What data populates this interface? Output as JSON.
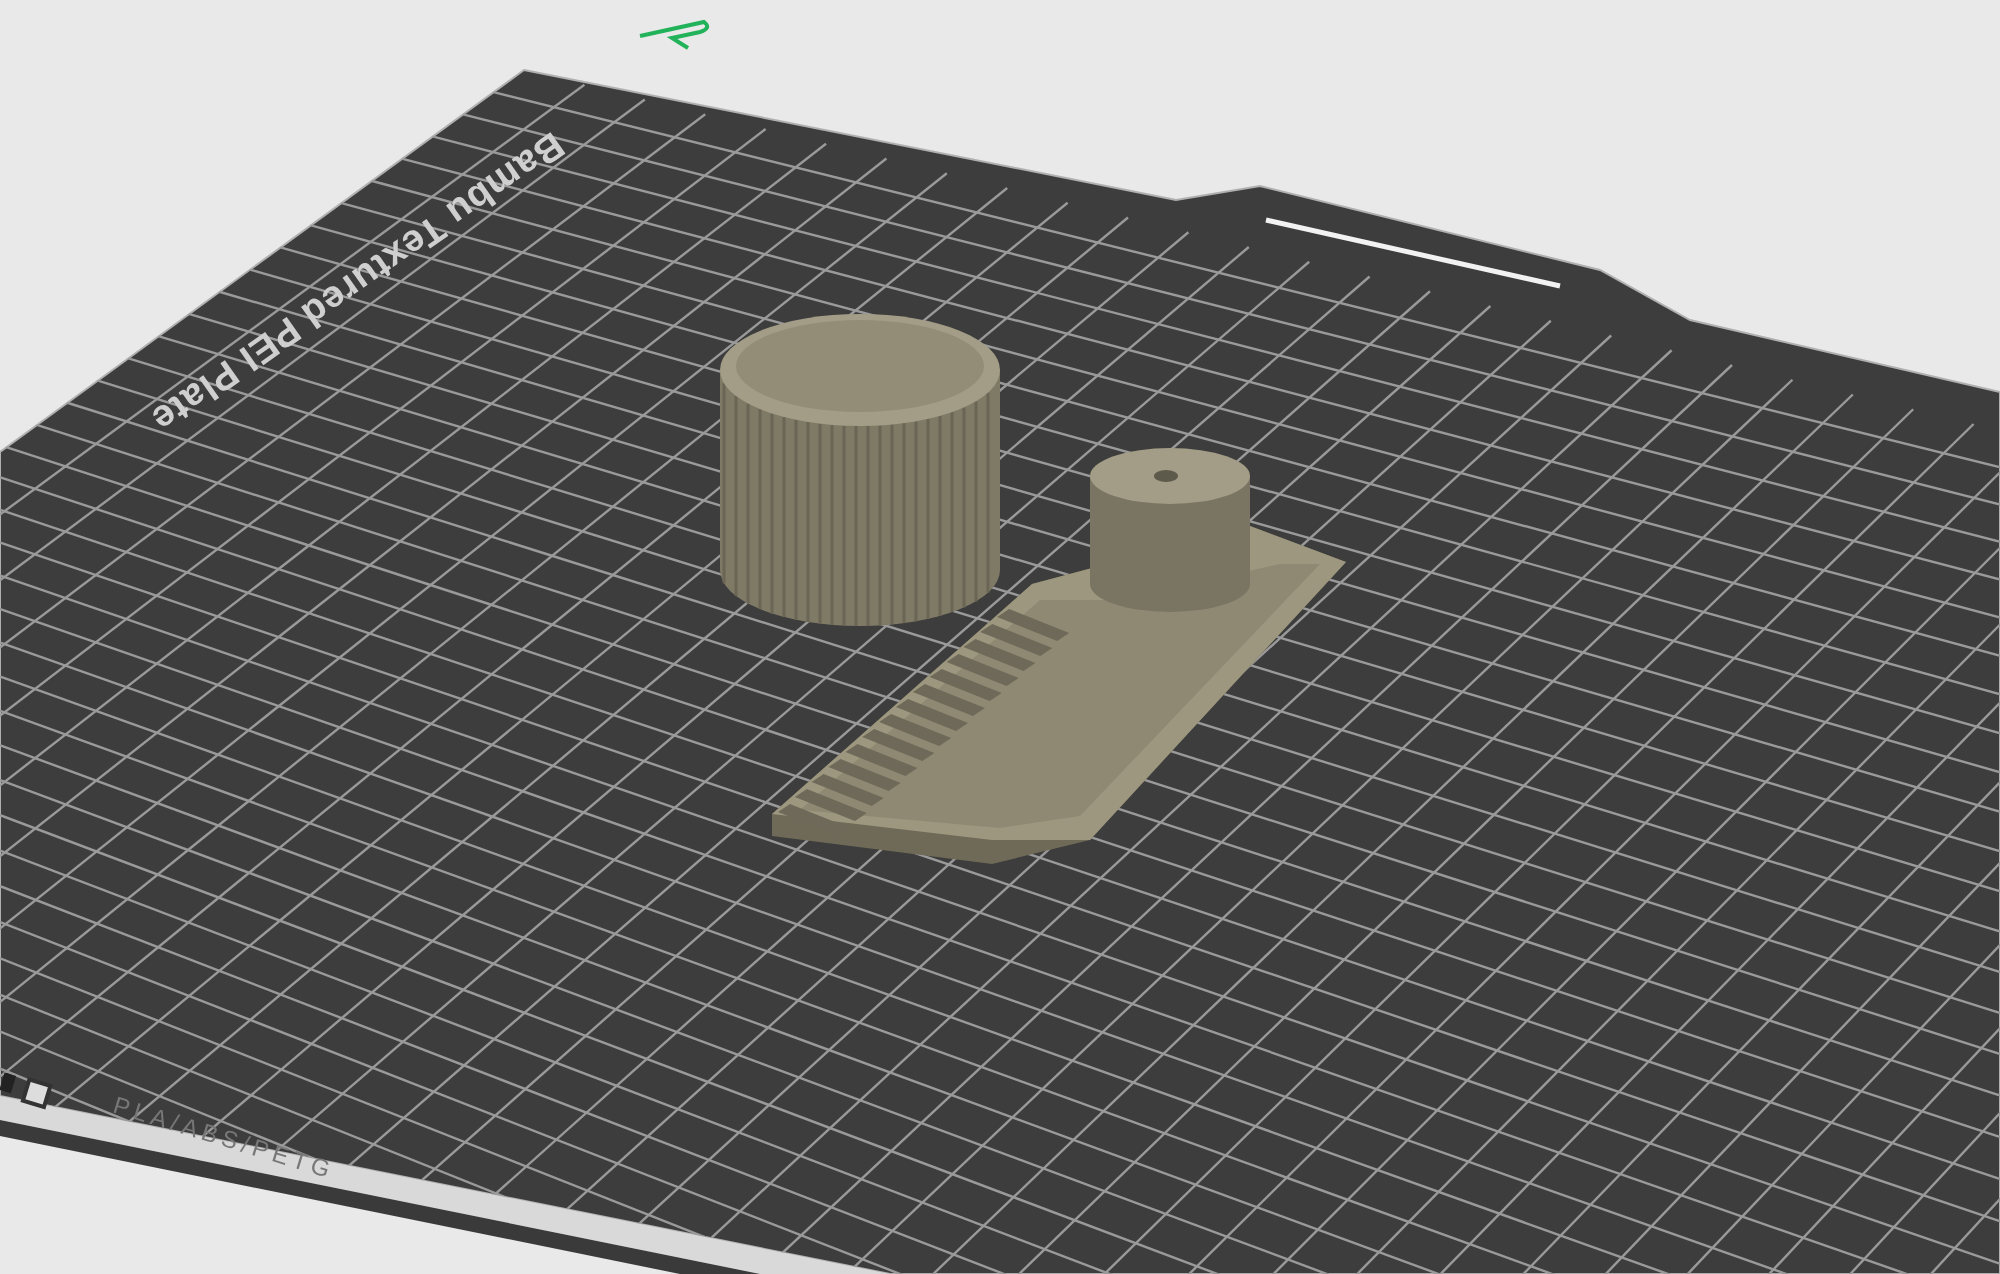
{
  "plate": {
    "name": "Bambu Textured PEI Plate",
    "filament_label": "PLA/ABS/PETG"
  }
}
